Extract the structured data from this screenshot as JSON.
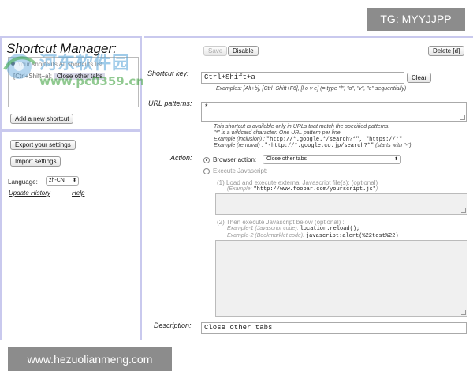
{
  "watermark_tag": "TG: MYYJJPP",
  "watermark_footer": "www.hezuolianmeng.com",
  "watermark_logo_text": "河东软件园",
  "watermark_url": "www.pc0359.cn",
  "sidebar": {
    "title": "Shortcut Manager:",
    "list_row_1": "Your shortcuts   All shortcuts list",
    "selected_key": "[Ctrl+Shift+a]:",
    "selected_desc": "Close other tabs",
    "add_button": "Add a new shortcut",
    "export_button": "Export your settings",
    "import_button": "Import settings",
    "language_label": "Language:",
    "language_value": "zh-CN",
    "update_history": "Update History",
    "help": "Help"
  },
  "toolbar": {
    "save": "Save",
    "disable": "Disable",
    "delete": "Delete [d]"
  },
  "form": {
    "shortcut_key_label": "Shortcut key:",
    "shortcut_key_value": "Ctrl+Shift+a",
    "clear_button": "Clear",
    "shortcut_examples": "Examples: [Alt+b], [Ctrl+Shift+F6], [l o v e] (= type \"l\", \"o\", \"v\", \"e\" sequentially)",
    "url_patterns_label": "URL patterns:",
    "url_patterns_value": "*",
    "url_note_1": "This shortcut is available only in URLs that match the specified patterns.",
    "url_note_2": "\"*\" is a wildcard character. One URL pattern per line.",
    "url_example_incl_label": "Example (inclusion) : ",
    "url_example_incl_code": "\"http://*.google.*/search?*\", \"https://*\"",
    "url_example_excl_label": "Example (removal) : ",
    "url_example_excl_code": "\"-http://*.google.co.jp/search?*\"",
    "url_example_excl_tail": " (starts with \"-\")",
    "action_label": "Action:",
    "browser_action_label": "Browser action:",
    "browser_action_value": "Close other tabs",
    "execute_js_label": "Execute Javascript:",
    "step1_label": "(1) Load and execute external Javascript file(s): (optional)",
    "step1_example_label": "(Example: ",
    "step1_example_code": "\"http://www.foobar.com/yourscript.js\"",
    "step1_example_tail": ")",
    "step2_label": "(2) Then execute Javascript below (optional) :",
    "step2_ex1_label": "Example-1 (Javascript code): ",
    "step2_ex1_code": "location.reload();",
    "step2_ex2_label": "Example-2 (Bookmarklet code): ",
    "step2_ex2_code": "javascript:alert(%22test%22)",
    "description_label": "Description:",
    "description_value": "Close other tabs"
  },
  "colors": {
    "panel_border": "#c9c9ee",
    "watermark_box": "#8c8c8c"
  }
}
